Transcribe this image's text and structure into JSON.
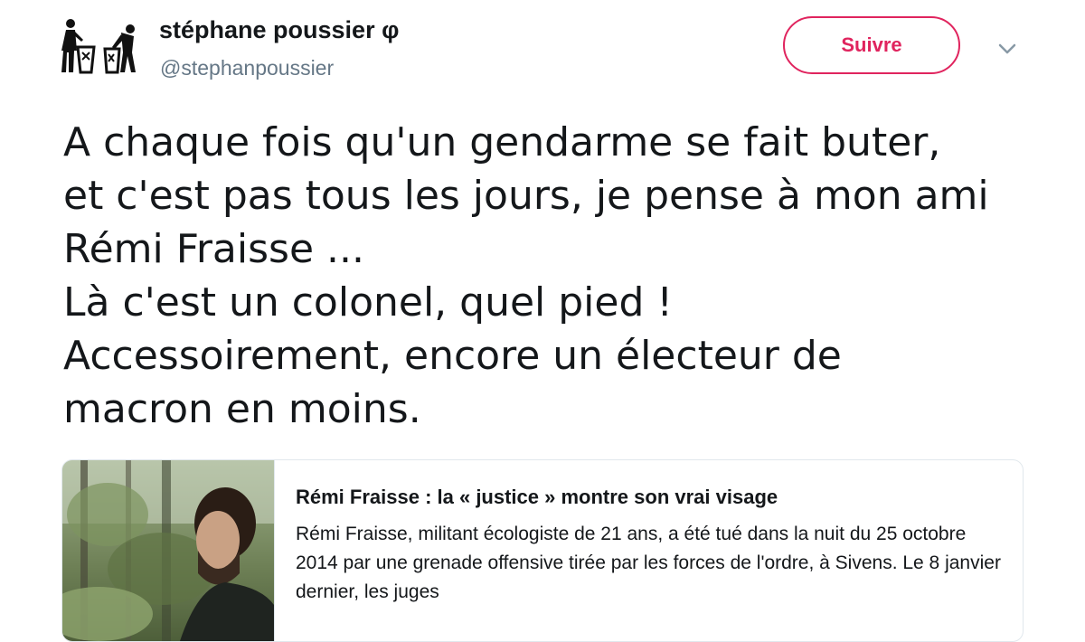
{
  "user": {
    "display_name": "stéphane poussier φ",
    "handle": "@stephanpoussier",
    "avatar_icon": "people-trash-bin-icon"
  },
  "actions": {
    "follow_label": "Suivre",
    "menu_icon": "chevron-down-icon"
  },
  "tweet": {
    "lines": [
      "A chaque fois qu'un gendarme se fait buter,",
      "et c'est pas tous les jours, je pense à mon ami",
      "Rémi Fraisse ...",
      "Là c'est un colonel, quel pied !",
      "Accessoirement, encore un électeur de",
      "macron en moins."
    ]
  },
  "card": {
    "image_icon": "forest-portrait-photo",
    "title": "Rémi Fraisse : la « justice » montre son vrai visage",
    "description": "Rémi Fraisse, militant écologiste de 21 ans, a été tué dans la nuit du 25 octobre 2014 par une grenade offensive tirée par les forces de l'ordre, à Sivens. Le 8 janvier dernier, les juges"
  },
  "colors": {
    "accent": "#e0245e",
    "text": "#14171a",
    "secondary_text": "#657786",
    "border": "#e1e8ed"
  }
}
